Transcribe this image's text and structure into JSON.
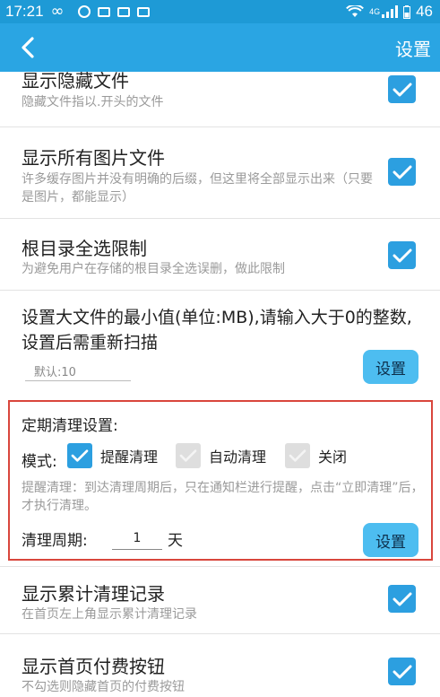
{
  "status_bar": {
    "time": "17:21",
    "network": "4G",
    "battery": "46"
  },
  "header": {
    "back_icon": "chevron-left-icon",
    "title": "设置"
  },
  "settings": {
    "show_hidden": {
      "title": "显示隐藏文件",
      "desc": "隐藏文件指以.开头的文件",
      "checked": true
    },
    "show_all_images": {
      "title": "显示所有图片文件",
      "desc": "许多缓存图片并没有明确的后缀，但这里将全部显示出来（只要是图片，都能显示）",
      "checked": true
    },
    "root_select_limit": {
      "title": "根目录全选限制",
      "desc": "为避免用户在存储的根目录全选误删，做此限制",
      "checked": true
    },
    "big_file": {
      "title": "设置大文件的最小值(单位:MB),请输入大于0的整数,设置后需重新扫描",
      "placeholder": "默认:10",
      "button": "设置"
    },
    "periodic_clean": {
      "title": "定期清理设置:",
      "mode_label": "模式:",
      "modes": [
        {
          "label": "提醒清理",
          "checked": true
        },
        {
          "label": "自动清理",
          "checked": false
        },
        {
          "label": "关闭",
          "checked": false
        }
      ],
      "desc": "提醒清理：到达清理周期后，只在通知栏进行提醒，点击“立即清理”后，才执行清理。",
      "period_label": "清理周期:",
      "period_value": "1",
      "period_unit": "天",
      "button": "设置"
    },
    "show_clean_record": {
      "title": "显示累计清理记录",
      "desc": "在首页左上角显示累计清理记录",
      "checked": true
    },
    "show_pay_button": {
      "title": "显示首页付费按钮",
      "desc": "不勾选则隐藏首页的付费按钮",
      "checked": true
    }
  },
  "colors": {
    "status_bar": "#1e9ad6",
    "header": "#2aa5e3",
    "checkbox_on": "#2c9fe0",
    "button": "#4dbdf0",
    "highlight_border": "#d9463c"
  }
}
